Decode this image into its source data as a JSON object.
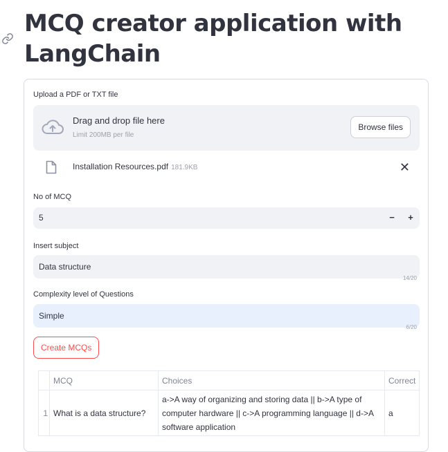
{
  "title": "MCQ creator application with LangChain",
  "upload": {
    "label": "Upload a PDF or TXT file",
    "drop_title": "Drag and drop file here",
    "drop_limit": "Limit 200MB per file",
    "browse_label": "Browse files",
    "file_name": "Installation Resources.pdf",
    "file_size": "181.9KB"
  },
  "num_mcq": {
    "label": "No of MCQ",
    "value": "5",
    "minus": "−",
    "plus": "+"
  },
  "subject": {
    "label": "Insert subject",
    "value": "Data structure",
    "count": "14/20"
  },
  "complexity": {
    "label": "Complexity level of Questions",
    "value": "Simple",
    "count": "6/20"
  },
  "create_button": "Create MCQs",
  "table": {
    "headers": [
      "",
      "MCQ",
      "Choices",
      "Correct"
    ],
    "rows": [
      {
        "index": "1",
        "mcq": "What is a data structure?",
        "choices": "a->A way of organizing and storing data || b->A type of computer hardware || c->A programming language || d->A software application",
        "correct": "a"
      }
    ]
  },
  "icons": {
    "anchor": "link-icon",
    "upload": "cloud-upload-icon",
    "file": "file-icon",
    "close": "close-icon"
  },
  "colors": {
    "accent": "#ff4b4b",
    "input_bg": "#f0f2f6",
    "focused_bg": "#e8f0fe",
    "text": "#31333f"
  }
}
